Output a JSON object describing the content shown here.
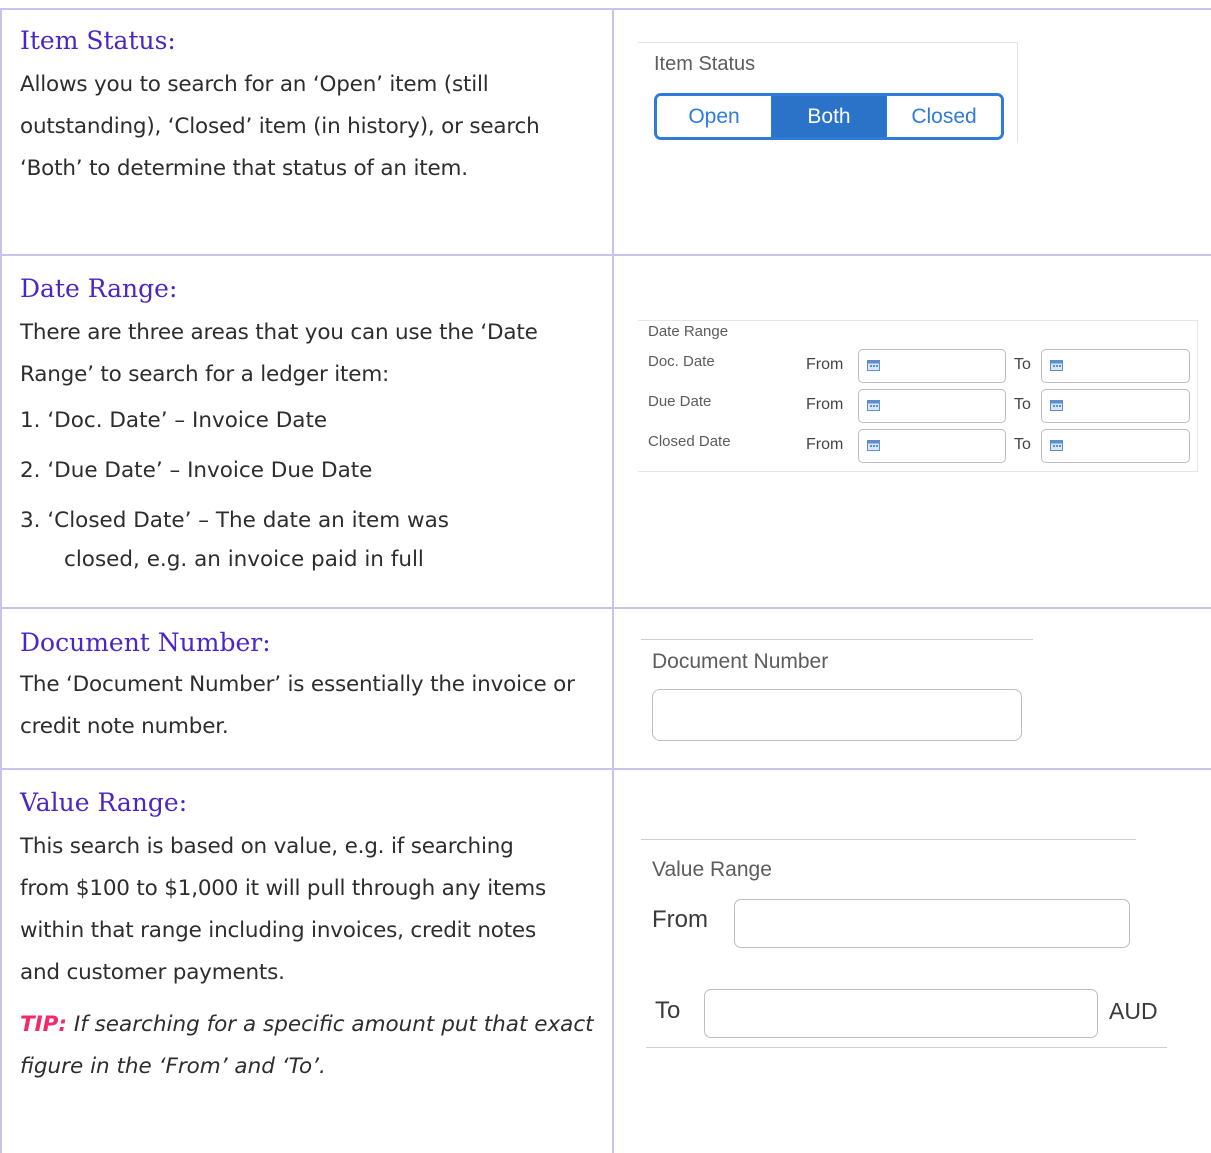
{
  "sections": [
    {
      "heading": "Item Status:",
      "body": "Allows you to search for an ‘Open’ item (still outstanding), ‘Closed’ item (in history), or search ‘Both’ to determine that status of an item."
    },
    {
      "heading": "Date Range:",
      "body": "There are three areas that you can use the ‘Date Range’ to search for a ledger item:",
      "list": [
        "1.  ‘Doc. Date’ – Invoice Date",
        "2.  ‘Due Date’ – Invoice Due Date",
        "3.  ‘Closed Date’ – The date an item was",
        "closed, e.g. an invoice paid in full"
      ]
    },
    {
      "heading": "Document Number:",
      "body": "The ‘Document Number’ is essentially the invoice or credit note number."
    },
    {
      "heading": "Value Range:",
      "body": "This search is based on value, e.g. if searching from $100 to $1,000 it will pull through any items within that range including invoices, credit notes and customer payments.",
      "tip_label": "TIP:",
      "tip_text": " If searching for a specific amount put that exact figure in the ‘From’ and ‘To’."
    }
  ],
  "widgets": {
    "item_status": {
      "title": "Item Status",
      "options": [
        "Open",
        "Both",
        "Closed"
      ],
      "selected": "Both",
      "accent": "#2f7bd7"
    },
    "date_range": {
      "title": "Date Range",
      "rows": [
        {
          "label": "Doc. Date",
          "from": "From",
          "to": "To"
        },
        {
          "label": "Due Date",
          "from": "From",
          "to": "To"
        },
        {
          "label": "Closed Date",
          "from": "From",
          "to": "To"
        }
      ],
      "icon": "calendar-icon"
    },
    "document_number": {
      "title": "Document Number",
      "value": ""
    },
    "value_range": {
      "title": "Value Range",
      "from_label": "From",
      "to_label": "To",
      "currency": "AUD",
      "from_value": "",
      "to_value": ""
    }
  },
  "colors": {
    "heading": "#4a26c8",
    "grid": "#c9c2ec",
    "tip_label": "#f5286a"
  }
}
